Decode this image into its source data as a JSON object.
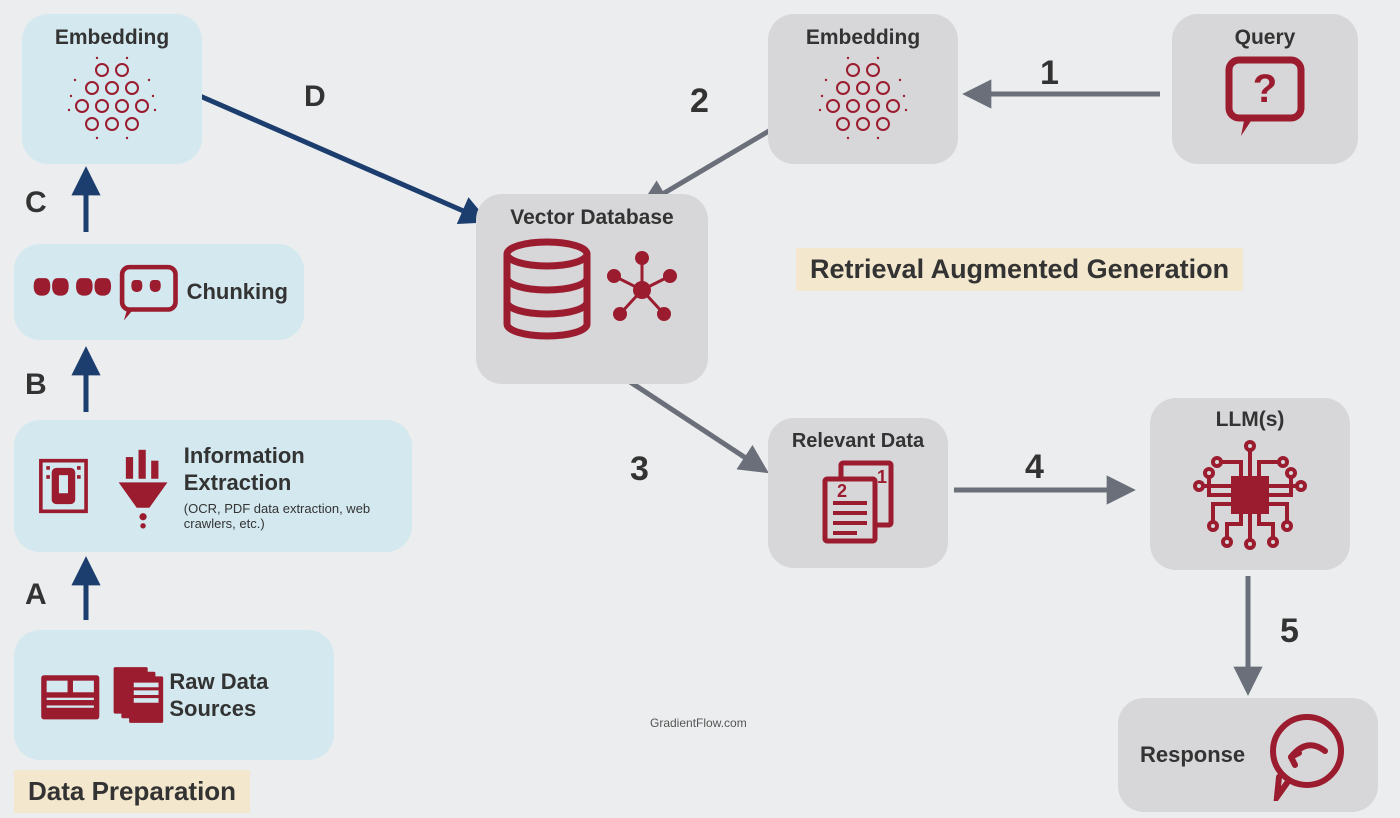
{
  "sections": {
    "data_prep": "Data Preparation",
    "rag": "Retrieval Augmented Generation"
  },
  "nodes": {
    "raw_data": {
      "label": "Raw Data Sources"
    },
    "info_extract": {
      "label": "Information Extraction",
      "sub": "(OCR, PDF data extraction, web crawlers, etc.)"
    },
    "chunking": {
      "label": "Chunking"
    },
    "embedding_left": {
      "label": "Embedding"
    },
    "vector_db": {
      "label": "Vector Database"
    },
    "embedding_right": {
      "label": "Embedding"
    },
    "query": {
      "label": "Query"
    },
    "relevant_data": {
      "label": "Relevant Data"
    },
    "llms": {
      "label": "LLM(s)"
    },
    "response": {
      "label": "Response"
    }
  },
  "steps": {
    "A": "A",
    "B": "B",
    "C": "C",
    "D": "D",
    "1": "1",
    "2": "2",
    "3": "3",
    "4": "4",
    "5": "5"
  },
  "credit": "GradientFlow.com",
  "colors": {
    "maroon": "#9b1c2e",
    "blueNode": "#d3e8ef",
    "grayNode": "#d7d7d9",
    "arrowBlue": "#1b3e6f",
    "arrowGray": "#6a6f7a",
    "banner": "#f3e8cd"
  }
}
